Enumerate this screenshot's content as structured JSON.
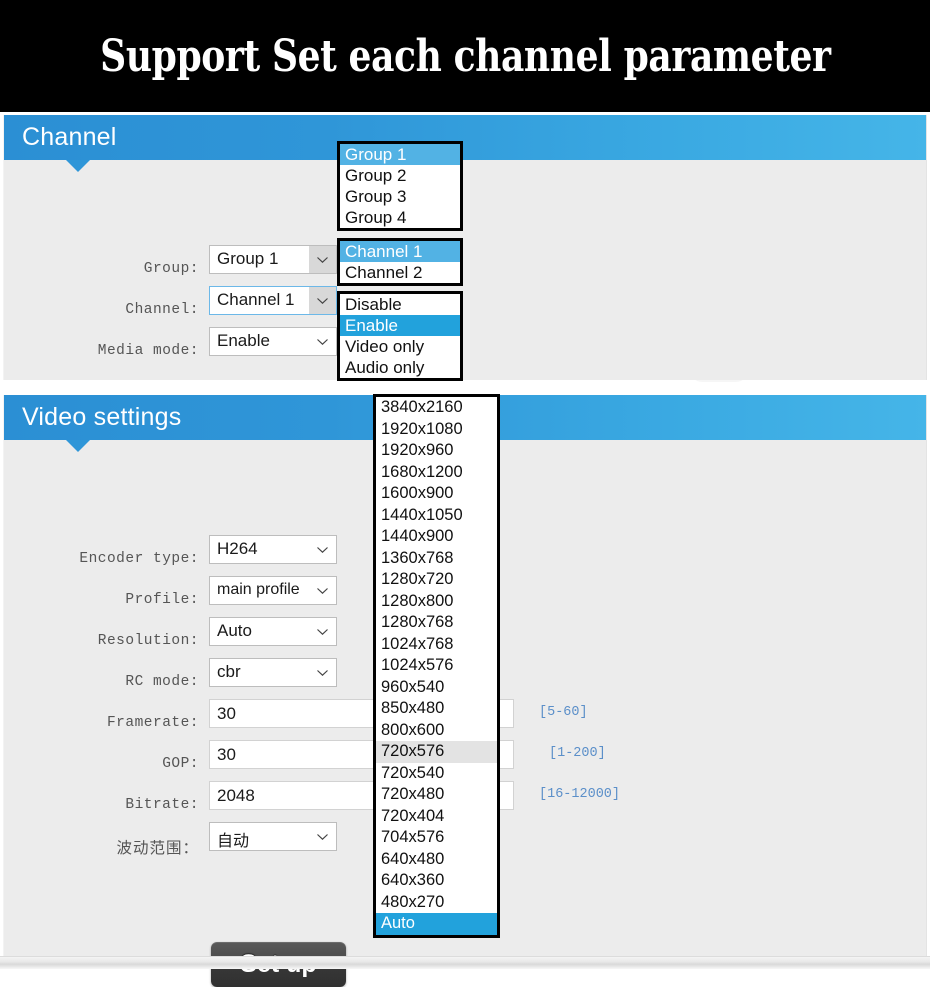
{
  "banner": {
    "title": "Support Set each channel parameter"
  },
  "channel_panel": {
    "header_title": "Channel",
    "fields": [
      {
        "label": "Group:",
        "value": "Group 1",
        "type": "select"
      },
      {
        "label": "Channel:",
        "value": "Channel 1",
        "type": "select"
      },
      {
        "label": "Media mode:",
        "value": "Enable",
        "type": "select"
      }
    ]
  },
  "video_panel": {
    "header_title": "Video settings",
    "fields": [
      {
        "label": "Encoder type:",
        "value": "H264",
        "type": "select",
        "hint": ""
      },
      {
        "label": "Profile:",
        "value": "main profile",
        "type": "select",
        "hint": ""
      },
      {
        "label": "Resolution:",
        "value": "Auto",
        "type": "select",
        "hint": ""
      },
      {
        "label": "RC mode:",
        "value": "cbr",
        "type": "select",
        "hint": ""
      },
      {
        "label": "Framerate:",
        "value": "30",
        "type": "input",
        "hint": "[5-60]"
      },
      {
        "label": "GOP:",
        "value": "30",
        "type": "input",
        "hint": "[1-200]"
      },
      {
        "label": "Bitrate:",
        "value": "2048",
        "type": "input",
        "hint": "[16-12000]"
      },
      {
        "label": "波动范围：",
        "value": "自动",
        "type": "select",
        "hint": ""
      }
    ],
    "setup_button_label": "Set up"
  },
  "popups": {
    "group": {
      "items": [
        "Group 1",
        "Group 2",
        "Group 3",
        "Group 4"
      ],
      "selected": "Group 1"
    },
    "channel": {
      "items": [
        "Channel 1",
        "Channel 2"
      ],
      "selected": "Channel 1"
    },
    "media_mode": {
      "items": [
        "Disable",
        "Enable",
        "Video only",
        "Audio only"
      ],
      "selected": "Enable"
    },
    "resolution": {
      "items": [
        "3840x2160",
        "1920x1080",
        "1920x960",
        "1680x1200",
        "1600x900",
        "1440x1050",
        "1440x900",
        "1360x768",
        "1280x720",
        "1280x800",
        "1280x768",
        "1024x768",
        "1024x576",
        "960x540",
        "850x480",
        "800x600",
        "720x576",
        "720x540",
        "720x480",
        "720x404",
        "704x576",
        "640x480",
        "640x360",
        "480x270",
        "Auto"
      ],
      "selected": "Auto",
      "hovered": "720x576"
    }
  },
  "colors": {
    "header_blue_left": "#2b8fd4",
    "header_blue_right": "#45b5e8",
    "highlight_light": "#52b2e4",
    "highlight_strong": "#22a2dc",
    "hint_text": "#5b8fc9",
    "panel_bg": "#ececec",
    "banner_bg": "#000000"
  },
  "icons": {
    "select_chevron": "chevron-down-icon"
  }
}
